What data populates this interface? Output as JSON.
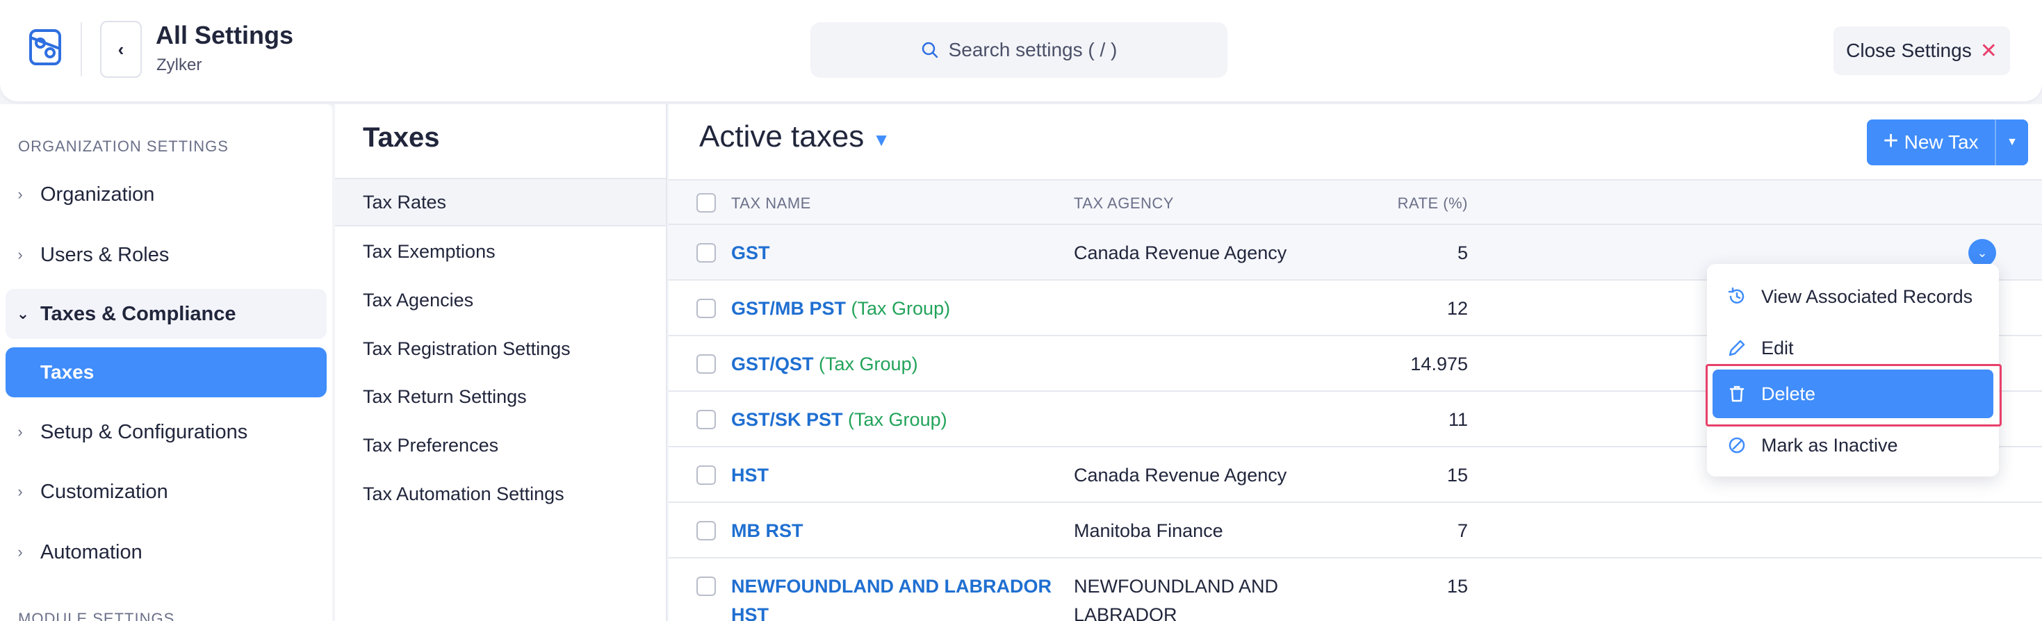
{
  "header": {
    "title": "All Settings",
    "subtitle": "Zylker",
    "search_placeholder": "Search settings ( / )",
    "close_label": "Close Settings"
  },
  "sidebar": {
    "section_label": "ORGANIZATION SETTINGS",
    "items": [
      {
        "label": "Organization",
        "expanded": false
      },
      {
        "label": "Users & Roles",
        "expanded": false
      },
      {
        "label": "Taxes & Compliance",
        "expanded": true
      },
      {
        "label": "Setup & Configurations",
        "expanded": false
      },
      {
        "label": "Customization",
        "expanded": false
      },
      {
        "label": "Automation",
        "expanded": false
      }
    ],
    "active_subitem": "Taxes",
    "section2_label": "MODULE SETTINGS"
  },
  "taxes_panel": {
    "title": "Taxes",
    "items": [
      "Tax Rates",
      "Tax Exemptions",
      "Tax Agencies",
      "Tax Registration Settings",
      "Tax Return Settings",
      "Tax Preferences",
      "Tax Automation Settings"
    ],
    "selected": "Tax Rates"
  },
  "main": {
    "title": "Active taxes",
    "new_button": "New Tax",
    "columns": {
      "name": "TAX NAME",
      "agency": "TAX AGENCY",
      "rate": "RATE (%)"
    },
    "rows": [
      {
        "name": "GST",
        "group": "",
        "agency": "Canada Revenue Agency",
        "rate": "5"
      },
      {
        "name": "GST/MB PST",
        "group": "(Tax Group)",
        "agency": "",
        "rate": "12"
      },
      {
        "name": "GST/QST",
        "group": "(Tax Group)",
        "agency": "",
        "rate": "14.975"
      },
      {
        "name": "GST/SK PST",
        "group": "(Tax Group)",
        "agency": "",
        "rate": "11"
      },
      {
        "name": "HST",
        "group": "",
        "agency": "Canada Revenue Agency",
        "rate": "15"
      },
      {
        "name": "MB RST",
        "group": "",
        "agency": "Manitoba Finance",
        "rate": "7"
      },
      {
        "name": "NEWFOUNDLAND AND LABRADOR HST",
        "group": "",
        "agency": "NEWFOUNDLAND AND LABRADOR",
        "rate": "15"
      }
    ]
  },
  "row_menu": {
    "items": [
      {
        "label": "View Associated Records",
        "icon": "history-icon"
      },
      {
        "label": "Edit",
        "icon": "pencil-icon"
      },
      {
        "label": "Delete",
        "icon": "trash-icon"
      },
      {
        "label": "Mark as Inactive",
        "icon": "inactive-icon"
      }
    ],
    "active": "Delete"
  },
  "colors": {
    "accent": "#408dfb",
    "link": "#1f6fd1",
    "group": "#22a35a",
    "danger": "#e8406b"
  }
}
